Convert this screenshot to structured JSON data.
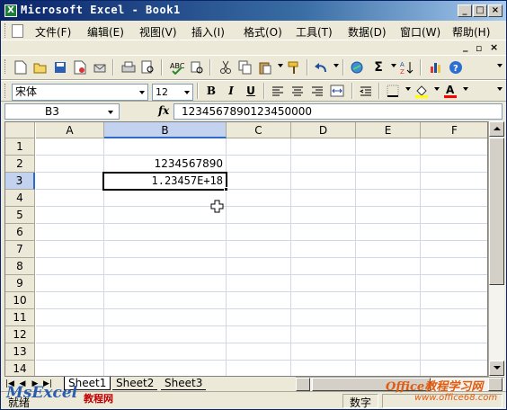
{
  "window": {
    "title": "Microsoft Excel - Book1"
  },
  "menu": {
    "items": [
      "文件(F)",
      "编辑(E)",
      "视图(V)",
      "插入(I)",
      "格式(O)",
      "工具(T)",
      "数据(D)",
      "窗口(W)",
      "帮助(H)"
    ]
  },
  "format_toolbar": {
    "font_name": "宋体",
    "font_size": "12"
  },
  "formula_bar": {
    "name_box": "B3",
    "fx": "fx",
    "content": "1234567890123450000"
  },
  "grid": {
    "columns": [
      "A",
      "B",
      "C",
      "D",
      "E",
      "F"
    ],
    "rows": [
      "1",
      "2",
      "3",
      "4",
      "5",
      "6",
      "7",
      "8",
      "9",
      "10",
      "11",
      "12",
      "13",
      "14"
    ],
    "cells": {
      "B2": "1234567890",
      "B3": "1.23457E+18"
    },
    "active_cell": "B3"
  },
  "sheet_tabs": [
    "Sheet1",
    "Sheet2",
    "Sheet3"
  ],
  "status_bar": {
    "mode": "就绪",
    "num": "数字"
  },
  "watermarks": {
    "left_brand": "MsExcel",
    "left_sub": "教程网",
    "right_brand": "Office教程学习网",
    "right_url": "www.office68.com"
  }
}
